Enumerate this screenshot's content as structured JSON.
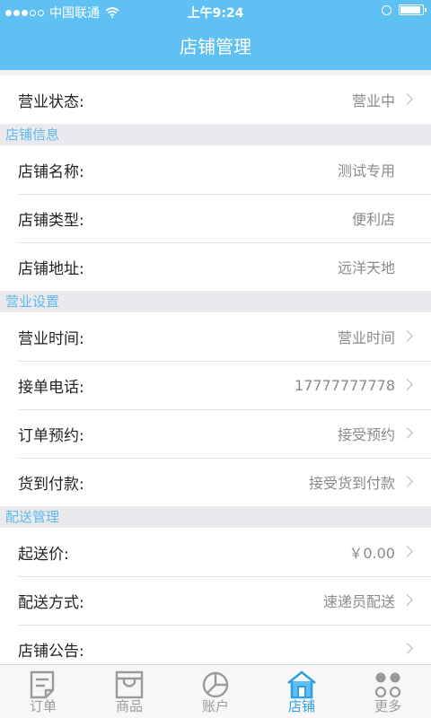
{
  "status_bar": {
    "carrier": "中国联通",
    "time": "上午9:24"
  },
  "nav": {
    "title": "店铺管理"
  },
  "business_status": {
    "label": "营业状态:",
    "value": "营业中"
  },
  "sections": {
    "shop_info": {
      "title": "店铺信息",
      "rows": [
        {
          "label": "店铺名称:",
          "value": "测试专用"
        },
        {
          "label": "店铺类型:",
          "value": "便利店"
        },
        {
          "label": "店铺地址:",
          "value": "远洋天地"
        }
      ]
    },
    "business_settings": {
      "title": "营业设置",
      "rows": [
        {
          "label": "营业时间:",
          "value": "营业时间"
        },
        {
          "label": "接单电话:",
          "value": "17777777778"
        },
        {
          "label": "订单预约:",
          "value": "接受预约"
        },
        {
          "label": "货到付款:",
          "value": "接受货到付款"
        }
      ]
    },
    "delivery": {
      "title": "配送管理",
      "rows": [
        {
          "label": "起送价:",
          "value": "￥0.00"
        },
        {
          "label": "配送方式:",
          "value": "速递员配送"
        },
        {
          "label": "店铺公告:",
          "value": ""
        }
      ]
    }
  },
  "tabs": [
    {
      "label": "订单",
      "icon": "order-icon"
    },
    {
      "label": "商品",
      "icon": "goods-icon"
    },
    {
      "label": "账户",
      "icon": "pie-chart-icon"
    },
    {
      "label": "店铺",
      "icon": "store-icon",
      "active": true
    },
    {
      "label": "更多",
      "icon": "more-icon"
    }
  ],
  "colors": {
    "accent": "#5fc0f4",
    "section_text": "#5db9e9",
    "tab_active": "#2c9fe5"
  }
}
